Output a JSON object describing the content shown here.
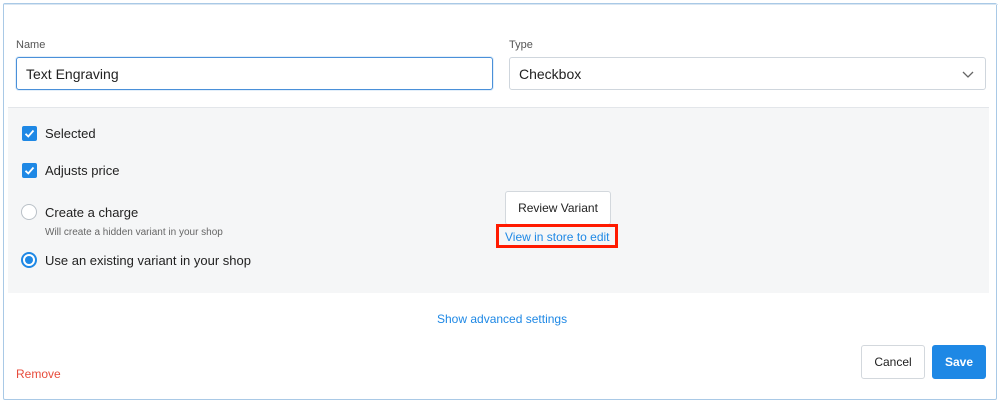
{
  "form": {
    "name_label": "Name",
    "name_value": "Text Engraving",
    "type_label": "Type",
    "type_value": "Checkbox"
  },
  "options": {
    "selected_label": "Selected",
    "selected_checked": true,
    "adjusts_price_label": "Adjusts price",
    "adjusts_price_checked": true,
    "create_charge_label": "Create a charge",
    "create_charge_hint": "Will create a hidden variant in your shop",
    "existing_variant_label": "Use an existing variant in your shop",
    "selected_radio": "existing_variant",
    "review_variant_label": "Review Variant",
    "view_in_store_label": "View in store to edit"
  },
  "footer": {
    "advanced_settings_label": "Show advanced settings",
    "remove_label": "Remove",
    "cancel_label": "Cancel",
    "save_label": "Save"
  },
  "colors": {
    "accent": "#1e88e5",
    "danger": "#e74c3c",
    "highlight": "#ff1a00",
    "panel_bg": "#f5f6f7"
  }
}
